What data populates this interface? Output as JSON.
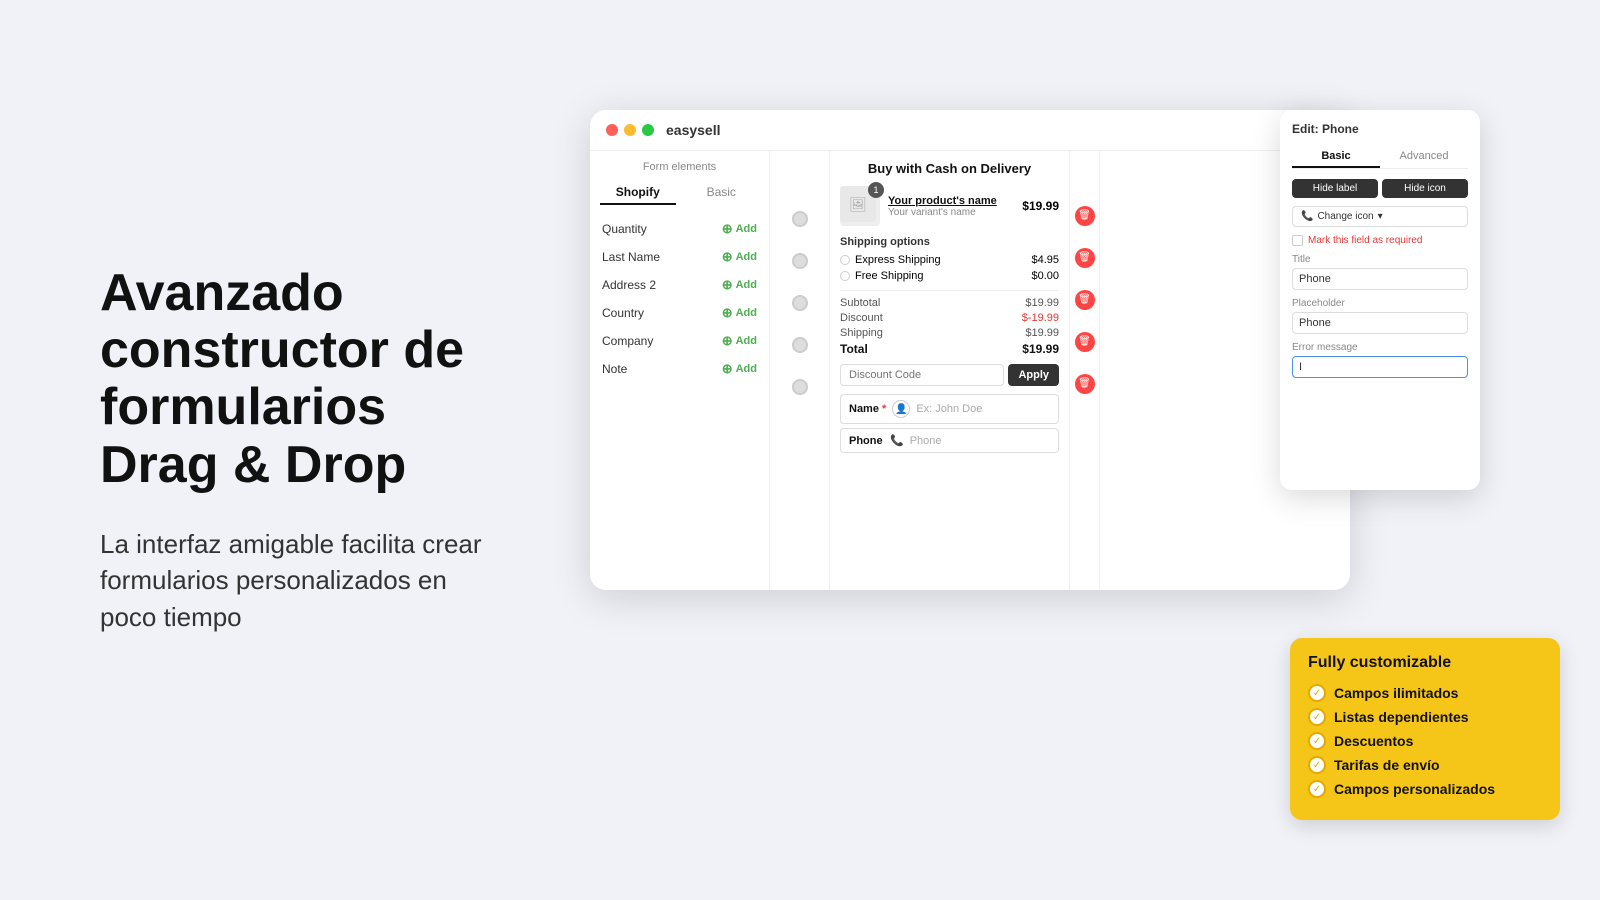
{
  "hero": {
    "title": "Avanzado constructor de formularios Drag & Drop",
    "subtitle": "La interfaz amigable facilita crear formularios personalizados en poco tiempo"
  },
  "app": {
    "title": "easysell",
    "tabs": {
      "shopify": "Shopify",
      "basic": "Basic"
    },
    "panel_title": "Form elements"
  },
  "form_items": [
    {
      "label": "Quantity",
      "add": "Add"
    },
    {
      "label": "Last Name",
      "add": "Add"
    },
    {
      "label": "Address 2",
      "add": "Add"
    },
    {
      "label": "Country",
      "add": "Add"
    },
    {
      "label": "Company",
      "add": "Add"
    },
    {
      "label": "Note",
      "add": "Add"
    }
  ],
  "order": {
    "title": "Buy with Cash on Delivery",
    "product_name": "Your product's name",
    "product_variant": "Your variant's name",
    "product_price": "$19.99",
    "product_badge": "1",
    "shipping": {
      "title": "Shipping options",
      "options": [
        {
          "label": "Express Shipping",
          "price": "$4.95"
        },
        {
          "label": "Free Shipping",
          "price": "$0.00"
        }
      ]
    },
    "summary": {
      "subtotal_label": "Subtotal",
      "subtotal_value": "$19.99",
      "discount_label": "Discount",
      "discount_value": "$-19.99",
      "shipping_label": "Shipping",
      "shipping_value": "$19.99",
      "total_label": "Total",
      "total_value": "$19.99"
    },
    "discount_placeholder": "Discount Code",
    "apply_label": "Apply",
    "name_field": {
      "label": "Name",
      "required": "*",
      "placeholder": "Ex: John Doe"
    },
    "phone_field": {
      "label": "Phone",
      "placeholder": "Phone"
    }
  },
  "edit_panel": {
    "title": "Edit: Phone",
    "tabs": {
      "basic": "Basic",
      "advanced": "Advanced"
    },
    "hide_label": "Hide label",
    "hide_icon": "Hide icon",
    "change_icon": "Change icon",
    "required_label": "Mark this field as required",
    "title_label": "Title",
    "title_value": "Phone",
    "placeholder_label": "Placeholder",
    "placeholder_value": "Phone",
    "error_label": "Error message",
    "error_value": "I"
  },
  "yellow_card": {
    "title": "Fully customizable",
    "features": [
      "Campos ilimitados",
      "Listas dependientes",
      "Descuentos",
      "Tarifas de envío",
      "Campos personalizados"
    ]
  }
}
